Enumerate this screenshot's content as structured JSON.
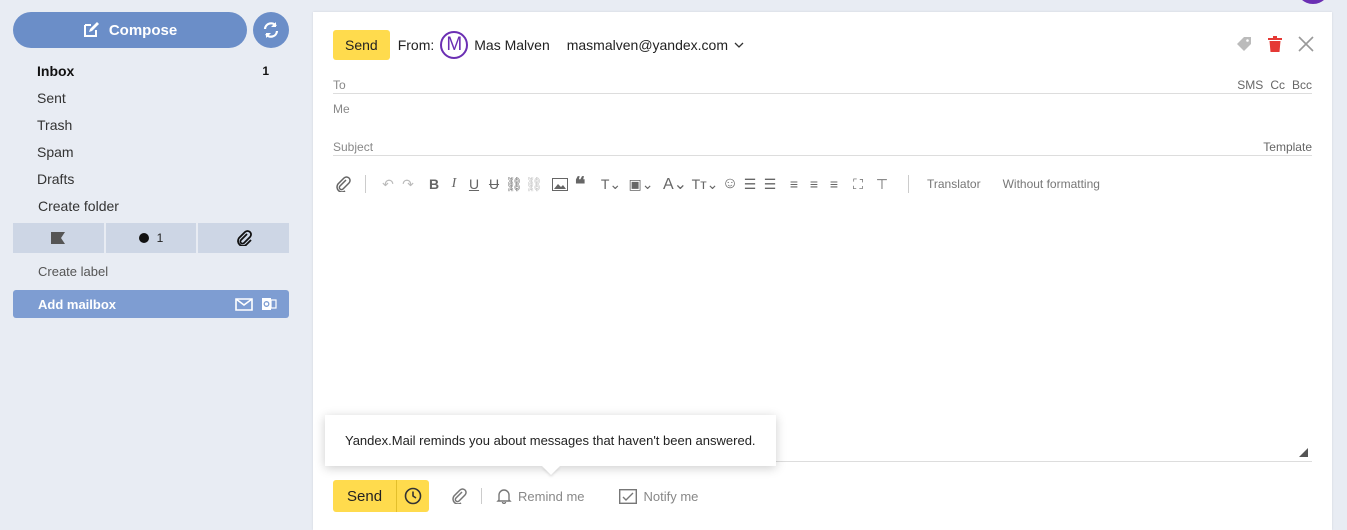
{
  "sidebar": {
    "compose_label": "Compose",
    "folders": [
      {
        "label": "Inbox",
        "count": "1"
      },
      {
        "label": "Sent",
        "count": ""
      },
      {
        "label": "Trash",
        "count": ""
      },
      {
        "label": "Spam",
        "count": ""
      },
      {
        "label": "Drafts",
        "count": ""
      },
      {
        "label": "Create folder",
        "count": ""
      }
    ],
    "filters": {
      "unread_count": "1"
    },
    "create_label": "Create label",
    "add_mailbox": "Add mailbox"
  },
  "compose": {
    "send_label": "Send",
    "from_label": "From:",
    "avatar_letter": "M",
    "from_name": "Mas Malven",
    "from_email": "masmalven@yandex.com",
    "to_label": "To",
    "sms": "SMS",
    "cc": "Cc",
    "bcc": "Bcc",
    "me_label": "Me",
    "subject_label": "Subject",
    "template_label": "Template",
    "toolbar": {
      "translator": "Translator",
      "without_formatting": "Without formatting"
    },
    "tooltip": "Yandex.Mail reminds you about messages that haven't been answered.",
    "bottom": {
      "send_label": "Send",
      "remind_label": "Remind me",
      "notify_label": "Notify me"
    }
  },
  "colors": {
    "accent_yellow": "#ffdb4d",
    "sidebar_blue": "#6b8ec8",
    "avatar_purple": "#6b2fb3",
    "delete_red": "#e53935"
  }
}
